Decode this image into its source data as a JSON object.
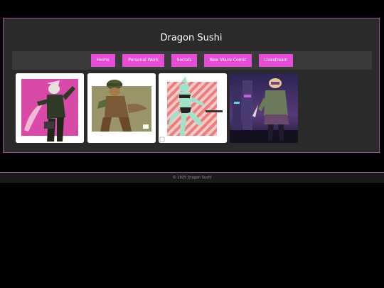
{
  "site": {
    "title": "Dragon Sushi"
  },
  "nav": {
    "items": [
      {
        "label": "Home"
      },
      {
        "label": "Personal Work"
      },
      {
        "label": "Socials"
      },
      {
        "label": "New Wave Comic"
      },
      {
        "label": "Livestream"
      }
    ]
  },
  "gallery": {
    "items": [
      {
        "icon": "artwork-pink-soldier"
      },
      {
        "icon": "artwork-helmet-creature"
      },
      {
        "icon": "artwork-mint-swimsuit"
      },
      {
        "icon": "artwork-neon-city-girl"
      }
    ]
  },
  "footer": {
    "copyright": "© 2025 Dragon Sushi"
  },
  "colors": {
    "page_background": "#000000",
    "panel_background": "#2a2a2a",
    "panel_border": "#9c4f9a",
    "nav_background": "#3a3a3a",
    "button_accent": "#e64ed7",
    "footer_background": "#1b1b1b"
  }
}
